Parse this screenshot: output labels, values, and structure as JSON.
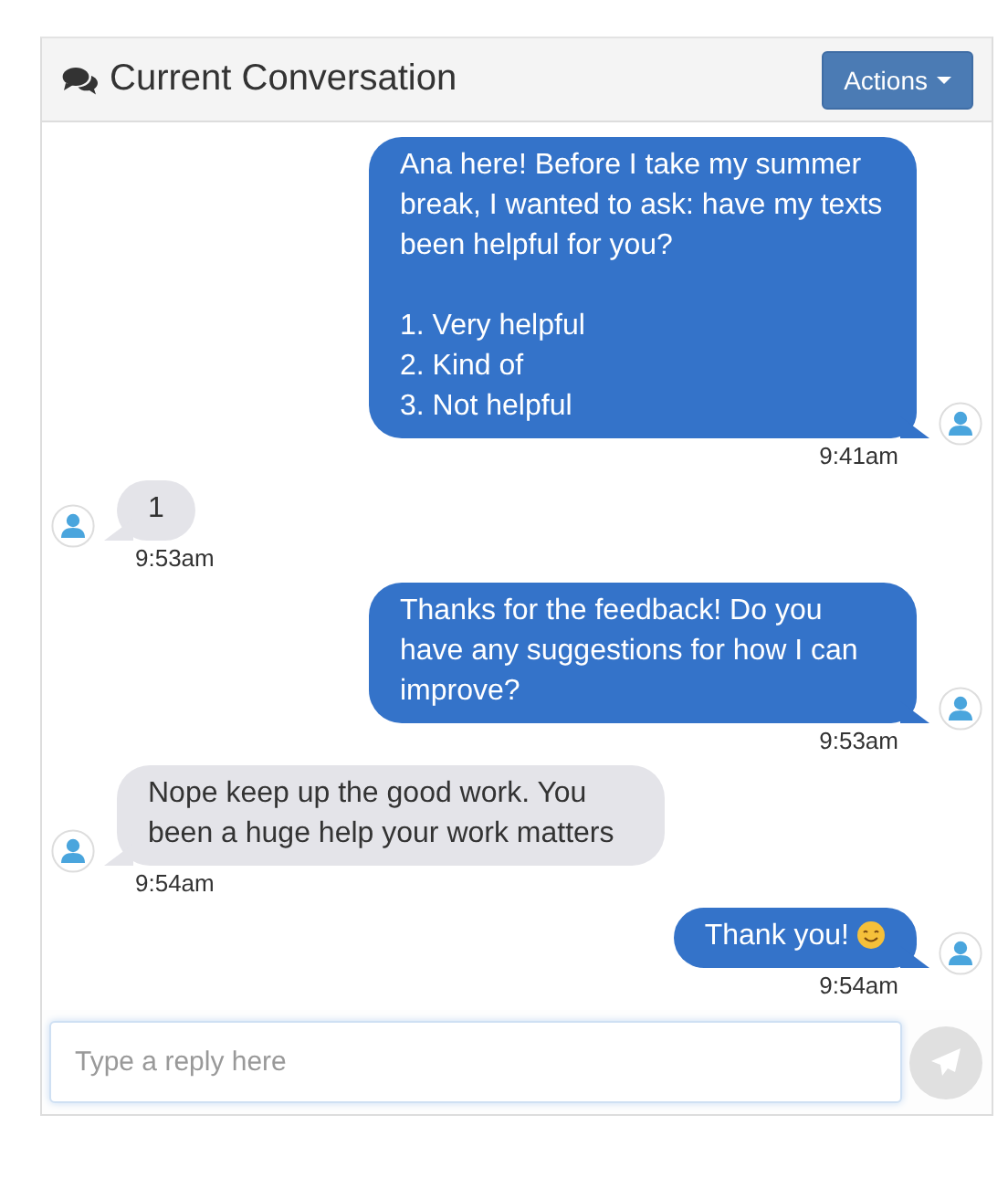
{
  "header": {
    "title": "Current Conversation",
    "actions_button": "Actions"
  },
  "messages": [
    {
      "kind": "outgoing",
      "text": "Ana here! Before I take my summer break, I wanted to ask: have my texts been helpful for you?\n\n1. Very helpful\n2. Kind of\n3. Not helpful",
      "time": "9:41am"
    },
    {
      "kind": "incoming",
      "text": "1",
      "time": "9:53am"
    },
    {
      "kind": "outgoing",
      "text": "Thanks for the feedback! Do you have any suggestions for how I can improve?",
      "time": "9:53am"
    },
    {
      "kind": "incoming",
      "text": "Nope keep up the good work. You been a huge help your work matters",
      "time": "9:54am"
    },
    {
      "kind": "outgoing",
      "text": "Thank you!",
      "smiley": true,
      "time": "9:54am"
    }
  ],
  "reply": {
    "placeholder": "Type a reply here"
  }
}
